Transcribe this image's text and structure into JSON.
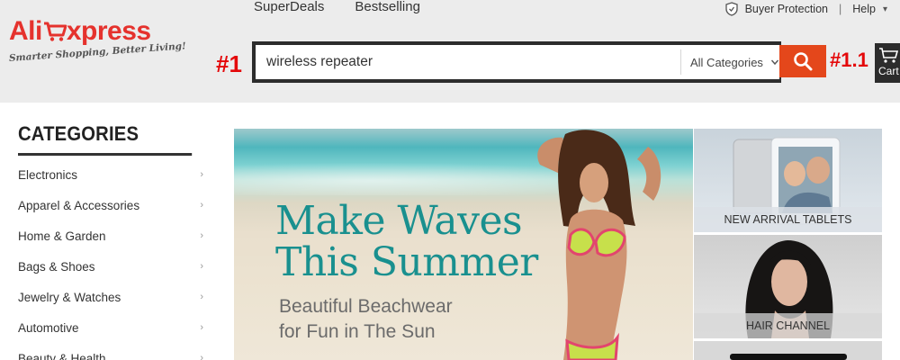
{
  "logo": {
    "brand_part1": "Ali",
    "brand_part2": "xpress",
    "tagline": "Smarter Shopping, Better Living!"
  },
  "top_nav": [
    {
      "label": "SuperDeals"
    },
    {
      "label": "Bestselling"
    }
  ],
  "utility": {
    "buyer_protection": "Buyer Protection",
    "separator": "|",
    "help": "Help"
  },
  "annotations": {
    "search_marker": "#1",
    "button_marker": "#1.1"
  },
  "search": {
    "value": "wireless repeater",
    "category": "All Categories"
  },
  "cart": {
    "label": "Cart"
  },
  "categories": {
    "title": "CATEGORIES",
    "items": [
      {
        "label": "Electronics"
      },
      {
        "label": "Apparel & Accessories"
      },
      {
        "label": "Home & Garden"
      },
      {
        "label": "Bags & Shoes"
      },
      {
        "label": "Jewelry & Watches"
      },
      {
        "label": "Automotive"
      },
      {
        "label": "Beauty & Health"
      }
    ],
    "arrow": "›"
  },
  "banner": {
    "headline_line1": "Make Waves",
    "headline_line2": "This Summer",
    "sub_line1": "Beautiful Beachwear",
    "sub_line2": "for Fun in The Sun"
  },
  "tiles": [
    {
      "label": "NEW ARRIVAL TABLETS"
    },
    {
      "label": "HAIR CHANNEL"
    }
  ],
  "colors": {
    "brand_red": "#e5322d",
    "search_button": "#e4471b",
    "annotation_red": "#e4080a",
    "banner_headline": "#19908f"
  }
}
